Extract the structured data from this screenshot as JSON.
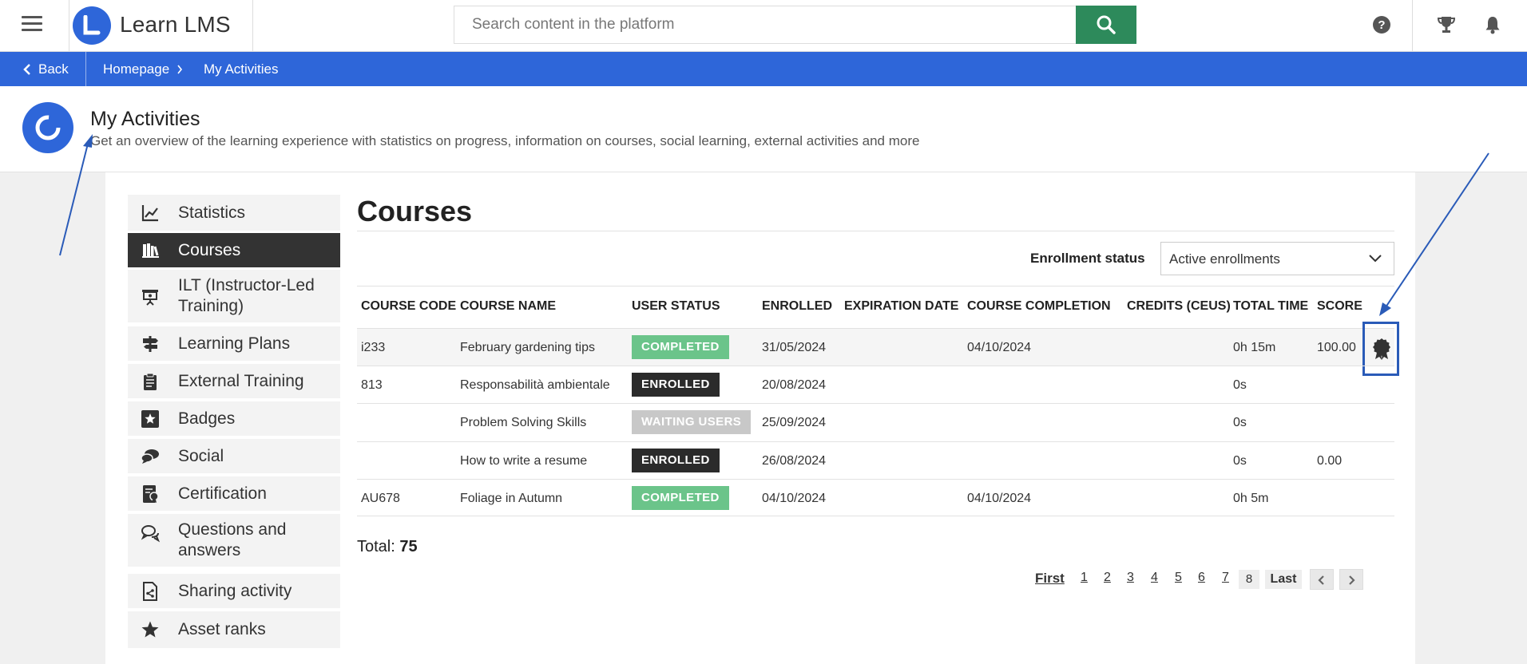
{
  "app": {
    "name": "Learn LMS"
  },
  "search": {
    "placeholder": "Search content in the platform"
  },
  "topbar_icons": [
    "help-icon",
    "trophy-icon",
    "bell-icon"
  ],
  "nav": {
    "back_label": "Back",
    "breadcrumb": [
      "Homepage",
      "My Activities"
    ]
  },
  "page": {
    "title": "My Activities",
    "subtitle": "Get an overview of the learning experience with statistics on progress, information on courses, social learning, external activities and more"
  },
  "sidebar": {
    "items": [
      {
        "label": "Statistics",
        "icon": "chart-icon"
      },
      {
        "label": "Courses",
        "icon": "books-icon",
        "active": true
      },
      {
        "label": "ILT (Instructor-Led Training)",
        "icon": "presentation-icon"
      },
      {
        "label": "Learning Plans",
        "icon": "signpost-icon"
      },
      {
        "label": "External Training",
        "icon": "clipboard-icon"
      },
      {
        "label": "Badges",
        "icon": "star-badge-icon"
      },
      {
        "label": "Social",
        "icon": "chat-bubbles-icon"
      },
      {
        "label": "Certification",
        "icon": "certificate-icon"
      },
      {
        "label": "Questions and answers",
        "icon": "questions-icon"
      },
      {
        "label": "Sharing activity",
        "icon": "share-document-icon"
      },
      {
        "label": "Asset ranks",
        "icon": "star-icon"
      }
    ]
  },
  "main": {
    "title": "Courses",
    "filter": {
      "label": "Enrollment status",
      "value": "Active enrollments"
    },
    "columns": [
      "COURSE CODE",
      "COURSE NAME",
      "USER STATUS",
      "ENROLLED",
      "EXPIRATION DATE",
      "COURSE COMPLETION",
      "CREDITS (CEUS)",
      "TOTAL TIME",
      "SCORE"
    ],
    "rows": [
      {
        "code": "i233",
        "name": "February gardening tips",
        "status": "COMPLETED",
        "enrolled": "31/05/2024",
        "expiration": "",
        "completion": "04/10/2024",
        "credits": "",
        "time": "0h 15m",
        "score": "100.00",
        "certificate": true
      },
      {
        "code": "813",
        "name": "Responsabilità ambientale",
        "status": "ENROLLED",
        "enrolled": "20/08/2024",
        "expiration": "",
        "completion": "",
        "credits": "",
        "time": "0s",
        "score": ""
      },
      {
        "code": "",
        "name": "Problem Solving Skills",
        "status": "WAITING USERS",
        "enrolled": "25/09/2024",
        "expiration": "",
        "completion": "",
        "credits": "",
        "time": "0s",
        "score": ""
      },
      {
        "code": "",
        "name": "How to write a resume",
        "status": "ENROLLED",
        "enrolled": "26/08/2024",
        "expiration": "",
        "completion": "",
        "credits": "",
        "time": "0s",
        "score": "0.00"
      },
      {
        "code": "AU678",
        "name": "Foliage in Autumn",
        "status": "COMPLETED",
        "enrolled": "04/10/2024",
        "expiration": "",
        "completion": "04/10/2024",
        "credits": "",
        "time": "0h 5m",
        "score": ""
      }
    ],
    "total_label": "Total:",
    "total_value": "75",
    "pagination": {
      "first": "First",
      "pages": [
        "1",
        "2",
        "3",
        "4",
        "5",
        "6",
        "7",
        "8"
      ],
      "current": "8",
      "last": "Last"
    }
  },
  "colors": {
    "brand": "#2e66d9",
    "search_button": "#2d8a5b",
    "completed": "#6bc48a",
    "enrolled": "#2b2b2b",
    "waiting": "#c8c8c8",
    "annotation": "#2a5bb8"
  }
}
